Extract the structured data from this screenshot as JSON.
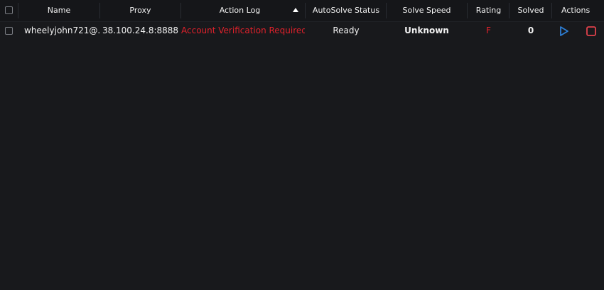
{
  "table": {
    "columns": {
      "name": "Name",
      "proxy": "Proxy",
      "action_log": "Action Log",
      "autosolve_status": "AutoSolve Status",
      "solve_speed": "Solve Speed",
      "rating": "Rating",
      "solved": "Solved",
      "actions": "Actions"
    },
    "sort": {
      "column": "Action Log",
      "direction": "ascending"
    },
    "rows": [
      {
        "name": "wheelyjohn721@...",
        "proxy": "38.100.24.8:8888",
        "action_log": "Account Verification Required",
        "autosolve_status": "Ready",
        "solve_speed": "Unknown",
        "rating": "F",
        "solved": "0",
        "actions": [
          "play-icon",
          "stop-icon"
        ]
      }
    ]
  },
  "colors": {
    "background": "#18191c",
    "header_background": "#151619",
    "text": "#f2f2f2",
    "error_red": "#e0212b",
    "play_blue": "#2e7fd6",
    "stop_red": "#e0414b"
  }
}
